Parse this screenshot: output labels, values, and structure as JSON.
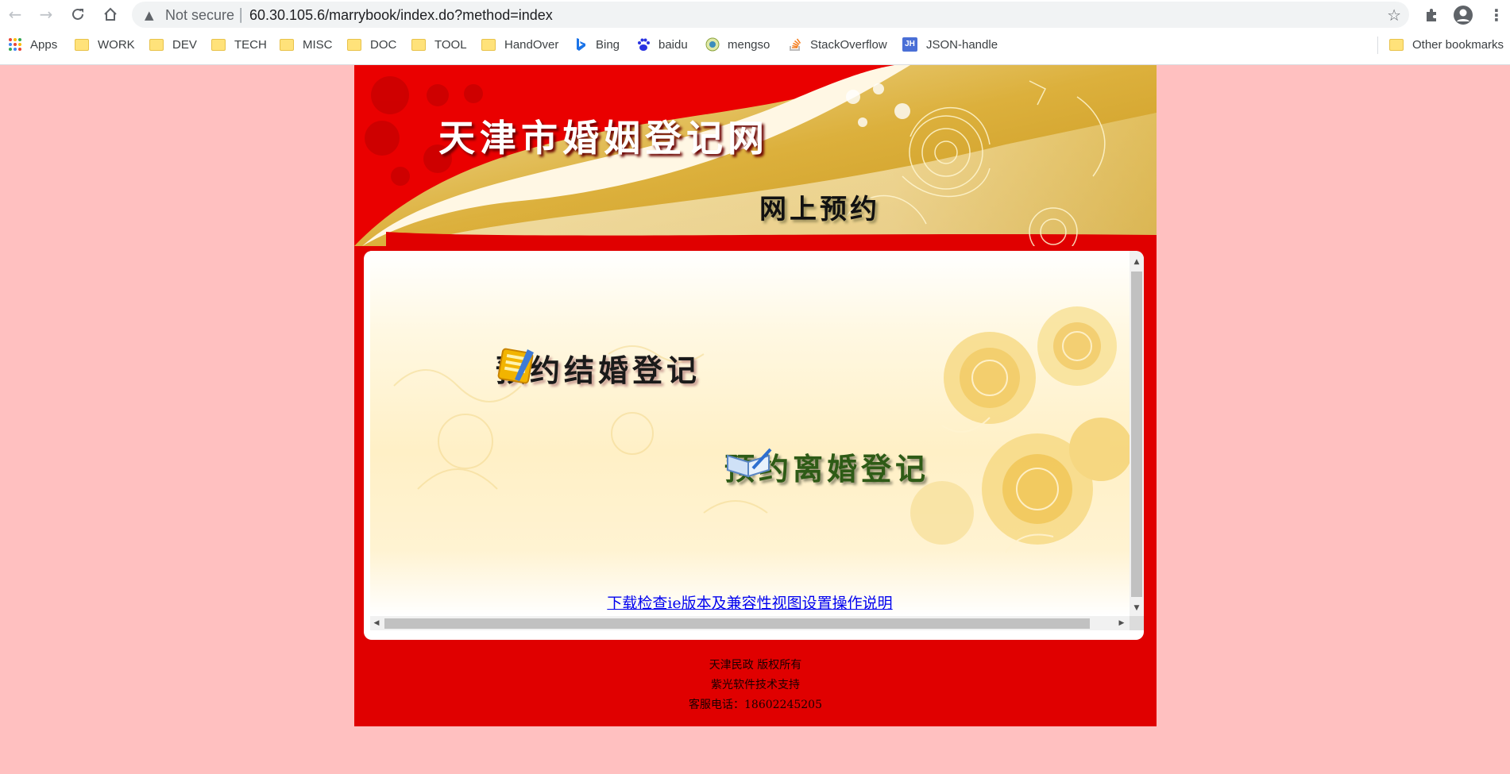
{
  "browser": {
    "security_label": "Not secure",
    "url": "60.30.105.6/marrybook/index.do?method=index"
  },
  "bookmarks": {
    "apps": "Apps",
    "items": [
      "WORK",
      "DEV",
      "TECH",
      "MISC",
      "DOC",
      "TOOL",
      "HandOver",
      "Bing",
      "baidu",
      "mengso",
      "StackOverflow",
      "JSON-handle"
    ],
    "jsonhandle_badge": "JH",
    "other": "Other bookmarks"
  },
  "banner": {
    "site_title": "天津市婚姻登记网",
    "subtitle": "网上预约"
  },
  "main": {
    "marry_button": "预约结婚登记",
    "divorce_button": "预约离婚登记",
    "help_link": "下载检查ie版本及兼容性视图设置操作说明"
  },
  "footer": {
    "line1": "天津民政 版权所有",
    "line2": "紫光软件技术支持",
    "line3": "客服电话：18602245205"
  },
  "colors": {
    "page_background": "#ffc0c0",
    "brand_red": "#e00000",
    "gold": "#d4a52a",
    "link": "#0000ee"
  }
}
